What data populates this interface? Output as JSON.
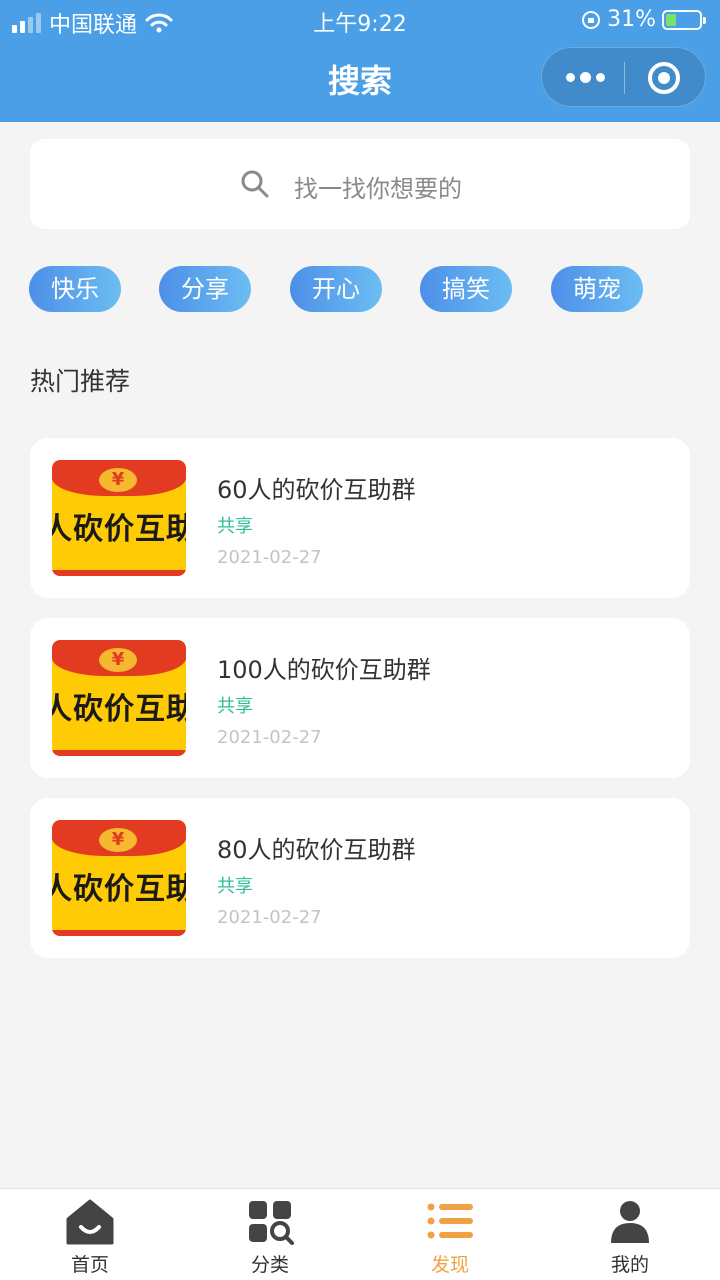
{
  "status_bar": {
    "carrier": "中国联通",
    "time": "上午9:22",
    "battery_percent": "31%",
    "battery_level": 0.31
  },
  "header": {
    "title": "搜索",
    "more_icon": "more-dots-icon",
    "close_icon": "target-close-icon",
    "background_color": "#4a9fe6"
  },
  "search": {
    "placeholder": "找一找你想要的"
  },
  "tags": [
    "快乐",
    "分享",
    "开心",
    "搞笑",
    "萌宠"
  ],
  "section_title": "热门推荐",
  "cards": [
    {
      "title": "60人的砍价互助群",
      "tag": "共享",
      "date": "2021-02-27",
      "thumb_coin": "¥",
      "thumb_text": "人砍价互助"
    },
    {
      "title": "100人的砍价互助群",
      "tag": "共享",
      "date": "2021-02-27",
      "thumb_coin": "¥",
      "thumb_text": "人砍价互助"
    },
    {
      "title": "80人的砍价互助群",
      "tag": "共享",
      "date": "2021-02-27",
      "thumb_coin": "¥",
      "thumb_text": "人砍价互助"
    }
  ],
  "tabbar": {
    "active_color": "#f0a243",
    "items": [
      {
        "label": "首页",
        "icon": "home-icon"
      },
      {
        "label": "分类",
        "icon": "category-icon"
      },
      {
        "label": "发现",
        "icon": "list-icon",
        "active": true
      },
      {
        "label": "我的",
        "icon": "user-icon"
      }
    ]
  }
}
